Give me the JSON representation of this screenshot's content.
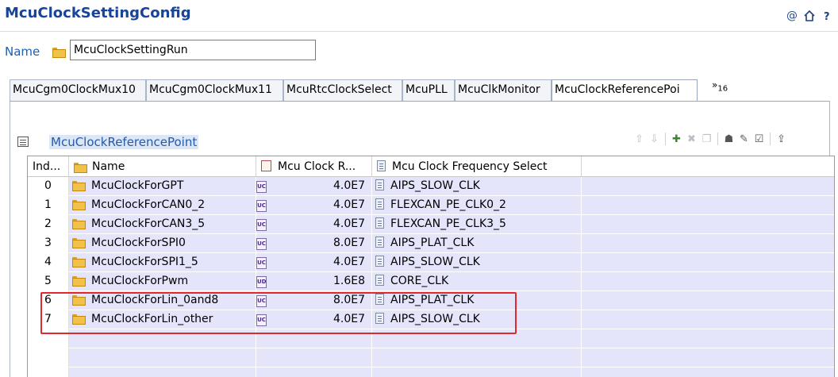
{
  "header": {
    "title": "McuClockSettingConfig",
    "icons": [
      "at-icon",
      "home-icon",
      "help-icon"
    ]
  },
  "name_field": {
    "label": "Name",
    "value": "McuClockSettingRun"
  },
  "tabs": [
    {
      "label": "McuCgm0ClockMux10",
      "active": false
    },
    {
      "label": "McuCgm0ClockMux11",
      "active": false
    },
    {
      "label": "McuRtcClockSelect",
      "active": false
    },
    {
      "label": "McuPLL",
      "active": false
    },
    {
      "label": "McuClkMonitor",
      "active": false
    },
    {
      "label": "McuClockReferencePoi",
      "active": true
    }
  ],
  "tabs_overflow": {
    "symbol": "»",
    "count": "16"
  },
  "section": {
    "title": "McuClockReferencePoint"
  },
  "toolbar": [
    "move-up-icon",
    "move-down-icon",
    "add-icon",
    "delete-icon",
    "copy-icon",
    "user-icon",
    "edit-icon",
    "edit-table-icon",
    "export-icon"
  ],
  "table": {
    "columns": [
      "Ind...",
      "Name",
      "Mcu Clock R...",
      "Mcu Clock Frequency Select"
    ],
    "rows": [
      {
        "index": "0",
        "name": "McuClockForGPT",
        "freq": "4.0E7",
        "select": "AIPS_SLOW_CLK"
      },
      {
        "index": "1",
        "name": "McuClockForCAN0_2",
        "freq": "4.0E7",
        "select": "FLEXCAN_PE_CLK0_2"
      },
      {
        "index": "2",
        "name": "McuClockForCAN3_5",
        "freq": "4.0E7",
        "select": "FLEXCAN_PE_CLK3_5"
      },
      {
        "index": "3",
        "name": "McuClockForSPI0",
        "freq": "8.0E7",
        "select": "AIPS_PLAT_CLK"
      },
      {
        "index": "4",
        "name": "McuClockForSPI1_5",
        "freq": "4.0E7",
        "select": "AIPS_SLOW_CLK"
      },
      {
        "index": "5",
        "name": "McuClockForPwm",
        "freq": "1.6E8",
        "select": "CORE_CLK"
      },
      {
        "index": "6",
        "name": "McuClockForLin_0and8",
        "freq": "8.0E7",
        "select": "AIPS_PLAT_CLK"
      },
      {
        "index": "7",
        "name": "McuClockForLin_other",
        "freq": "4.0E7",
        "select": "AIPS_SLOW_CLK"
      }
    ],
    "highlight_color": "#e0282e"
  }
}
